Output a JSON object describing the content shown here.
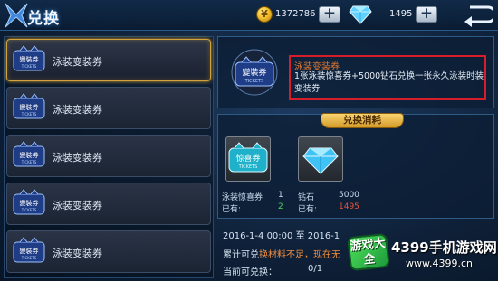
{
  "header": {
    "title": "兑换",
    "gold_amount": "1372786",
    "diamond_amount": "1495",
    "plus_label": "+"
  },
  "list": {
    "items": [
      {
        "label": "泳装变装券",
        "selected": true
      },
      {
        "label": "泳装变装券",
        "selected": false
      },
      {
        "label": "泳装变装券",
        "selected": false
      },
      {
        "label": "泳装变装券",
        "selected": false
      },
      {
        "label": "泳装变装券",
        "selected": false
      }
    ],
    "badge_text": "變裝券",
    "badge_sub": "TICKETS"
  },
  "detail": {
    "badge_text": "變裝券",
    "badge_sub": "TICKETS",
    "title": "泳装变装券",
    "description": "1张泳装惊喜券+5000钻石兑换一张永久泳装时装变装券"
  },
  "cost": {
    "header": "兑换消耗",
    "items": [
      {
        "icon": "surprise-ticket-icon",
        "badge_text": "惊喜券",
        "badge_sub": "TICKETS",
        "name": "泳装惊喜券",
        "need": "1",
        "have_label": "已有:",
        "have": "2"
      },
      {
        "icon": "diamond-icon",
        "name": "钻石",
        "need": "5000",
        "have_label": "已有:",
        "have": "1495"
      }
    ]
  },
  "bottom": {
    "period": "2016-1-4 00:00 至 2016-1",
    "limit_prefix": "累计可兑",
    "limit_warn": "换材料不足，现在无",
    "now_label": "当前可兑换：",
    "now_value": "0/1"
  },
  "watermark": {
    "logo": "游戏大全",
    "line1": "4399手机游戏网",
    "line2": "www.4399.cn"
  },
  "colors": {
    "selected_border": "#d4a23c",
    "highlight_box": "#d61e2a",
    "enough": "#49d45a",
    "not_enough": "#e6543b"
  }
}
